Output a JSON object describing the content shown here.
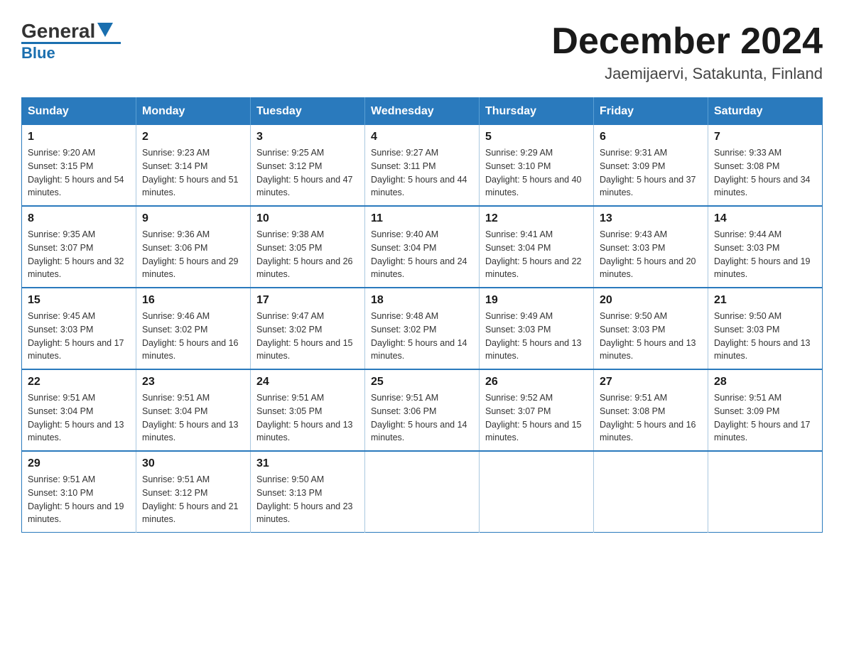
{
  "header": {
    "logo": {
      "general": "General",
      "blue": "Blue"
    },
    "title": "December 2024",
    "location": "Jaemijaervi, Satakunta, Finland"
  },
  "days_of_week": [
    "Sunday",
    "Monday",
    "Tuesday",
    "Wednesday",
    "Thursday",
    "Friday",
    "Saturday"
  ],
  "weeks": [
    [
      {
        "day": "1",
        "sunrise": "9:20 AM",
        "sunset": "3:15 PM",
        "daylight": "5 hours and 54 minutes."
      },
      {
        "day": "2",
        "sunrise": "9:23 AM",
        "sunset": "3:14 PM",
        "daylight": "5 hours and 51 minutes."
      },
      {
        "day": "3",
        "sunrise": "9:25 AM",
        "sunset": "3:12 PM",
        "daylight": "5 hours and 47 minutes."
      },
      {
        "day": "4",
        "sunrise": "9:27 AM",
        "sunset": "3:11 PM",
        "daylight": "5 hours and 44 minutes."
      },
      {
        "day": "5",
        "sunrise": "9:29 AM",
        "sunset": "3:10 PM",
        "daylight": "5 hours and 40 minutes."
      },
      {
        "day": "6",
        "sunrise": "9:31 AM",
        "sunset": "3:09 PM",
        "daylight": "5 hours and 37 minutes."
      },
      {
        "day": "7",
        "sunrise": "9:33 AM",
        "sunset": "3:08 PM",
        "daylight": "5 hours and 34 minutes."
      }
    ],
    [
      {
        "day": "8",
        "sunrise": "9:35 AM",
        "sunset": "3:07 PM",
        "daylight": "5 hours and 32 minutes."
      },
      {
        "day": "9",
        "sunrise": "9:36 AM",
        "sunset": "3:06 PM",
        "daylight": "5 hours and 29 minutes."
      },
      {
        "day": "10",
        "sunrise": "9:38 AM",
        "sunset": "3:05 PM",
        "daylight": "5 hours and 26 minutes."
      },
      {
        "day": "11",
        "sunrise": "9:40 AM",
        "sunset": "3:04 PM",
        "daylight": "5 hours and 24 minutes."
      },
      {
        "day": "12",
        "sunrise": "9:41 AM",
        "sunset": "3:04 PM",
        "daylight": "5 hours and 22 minutes."
      },
      {
        "day": "13",
        "sunrise": "9:43 AM",
        "sunset": "3:03 PM",
        "daylight": "5 hours and 20 minutes."
      },
      {
        "day": "14",
        "sunrise": "9:44 AM",
        "sunset": "3:03 PM",
        "daylight": "5 hours and 19 minutes."
      }
    ],
    [
      {
        "day": "15",
        "sunrise": "9:45 AM",
        "sunset": "3:03 PM",
        "daylight": "5 hours and 17 minutes."
      },
      {
        "day": "16",
        "sunrise": "9:46 AM",
        "sunset": "3:02 PM",
        "daylight": "5 hours and 16 minutes."
      },
      {
        "day": "17",
        "sunrise": "9:47 AM",
        "sunset": "3:02 PM",
        "daylight": "5 hours and 15 minutes."
      },
      {
        "day": "18",
        "sunrise": "9:48 AM",
        "sunset": "3:02 PM",
        "daylight": "5 hours and 14 minutes."
      },
      {
        "day": "19",
        "sunrise": "9:49 AM",
        "sunset": "3:03 PM",
        "daylight": "5 hours and 13 minutes."
      },
      {
        "day": "20",
        "sunrise": "9:50 AM",
        "sunset": "3:03 PM",
        "daylight": "5 hours and 13 minutes."
      },
      {
        "day": "21",
        "sunrise": "9:50 AM",
        "sunset": "3:03 PM",
        "daylight": "5 hours and 13 minutes."
      }
    ],
    [
      {
        "day": "22",
        "sunrise": "9:51 AM",
        "sunset": "3:04 PM",
        "daylight": "5 hours and 13 minutes."
      },
      {
        "day": "23",
        "sunrise": "9:51 AM",
        "sunset": "3:04 PM",
        "daylight": "5 hours and 13 minutes."
      },
      {
        "day": "24",
        "sunrise": "9:51 AM",
        "sunset": "3:05 PM",
        "daylight": "5 hours and 13 minutes."
      },
      {
        "day": "25",
        "sunrise": "9:51 AM",
        "sunset": "3:06 PM",
        "daylight": "5 hours and 14 minutes."
      },
      {
        "day": "26",
        "sunrise": "9:52 AM",
        "sunset": "3:07 PM",
        "daylight": "5 hours and 15 minutes."
      },
      {
        "day": "27",
        "sunrise": "9:51 AM",
        "sunset": "3:08 PM",
        "daylight": "5 hours and 16 minutes."
      },
      {
        "day": "28",
        "sunrise": "9:51 AM",
        "sunset": "3:09 PM",
        "daylight": "5 hours and 17 minutes."
      }
    ],
    [
      {
        "day": "29",
        "sunrise": "9:51 AM",
        "sunset": "3:10 PM",
        "daylight": "5 hours and 19 minutes."
      },
      {
        "day": "30",
        "sunrise": "9:51 AM",
        "sunset": "3:12 PM",
        "daylight": "5 hours and 21 minutes."
      },
      {
        "day": "31",
        "sunrise": "9:50 AM",
        "sunset": "3:13 PM",
        "daylight": "5 hours and 23 minutes."
      },
      null,
      null,
      null,
      null
    ]
  ]
}
